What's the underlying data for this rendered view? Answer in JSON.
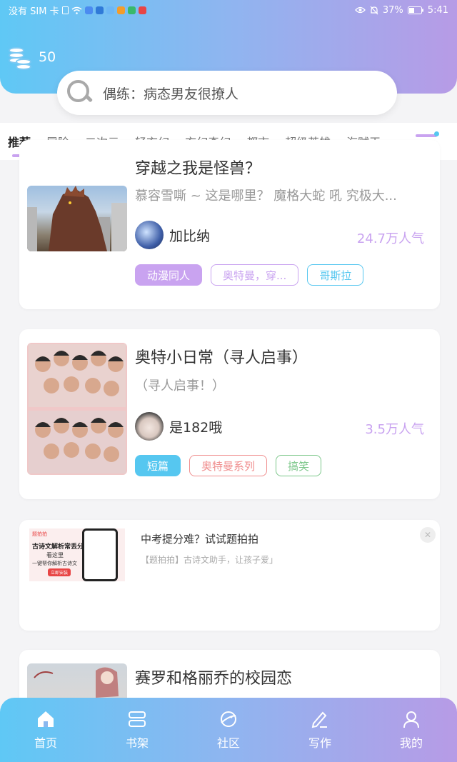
{
  "status_bar": {
    "carrier": "没有 SIM 卡",
    "battery": "37%",
    "time": "5:41"
  },
  "header": {
    "coins_icon": "coin-stack-icon",
    "coins": "50",
    "search_placeholder": "偶练：病态男友很撩人"
  },
  "tabs": [
    {
      "label": "推荐",
      "active": true
    },
    {
      "label": "冒险"
    },
    {
      "label": "二次元"
    },
    {
      "label": "轻玄幻"
    },
    {
      "label": "玄幻奇幻"
    },
    {
      "label": "都市"
    },
    {
      "label": "超级英雄"
    },
    {
      "label": "海贼王"
    }
  ],
  "feed": [
    {
      "title": "穿越之我是怪兽？",
      "desc": "慕容雪嘶 ~ 这是哪里？ 魔格大蛇 吼 究极大...",
      "author": "加比纳",
      "popularity": "24.7万人气",
      "tags": [
        "动漫同人",
        "奥特曼，穿...",
        "哥斯拉"
      ]
    },
    {
      "title": "奥特小日常（寻人启事）",
      "desc": "（寻人启事！）",
      "author": "是182哦",
      "popularity": "3.5万人气",
      "tags": [
        "短篇",
        "奥特曼系列",
        "搞笑"
      ]
    },
    {
      "title": "赛罗和格丽乔的校园恋"
    }
  ],
  "ad": {
    "title": "中考提分难？试试题拍拍",
    "subtitle": "【题拍拍】古诗文助手，让孩子爱」",
    "image_brand": "题拍拍",
    "image_headline": "古诗文解析常丢分",
    "image_line2": "看这里",
    "image_line3": "一键帮你解析古诗文",
    "image_button": "立即安装",
    "close": "✕"
  },
  "bottom_nav": [
    {
      "label": "首页",
      "icon": "home-icon"
    },
    {
      "label": "书架",
      "icon": "bookshelf-icon"
    },
    {
      "label": "社区",
      "icon": "planet-icon"
    },
    {
      "label": "写作",
      "icon": "pen-icon"
    },
    {
      "label": "我的",
      "icon": "user-icon"
    }
  ]
}
